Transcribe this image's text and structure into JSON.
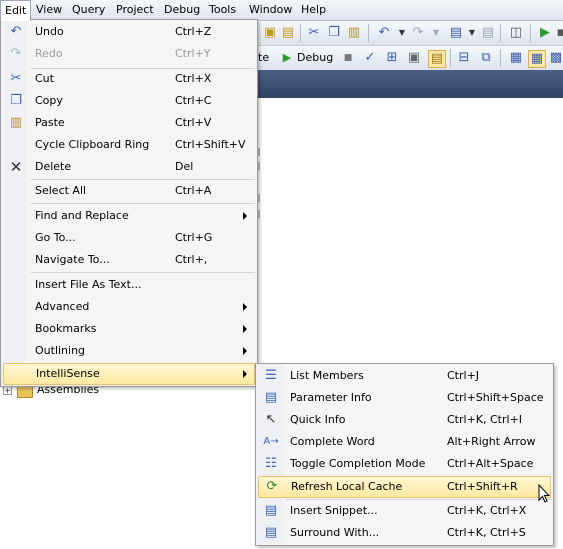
{
  "menubar": {
    "items": [
      "Edit",
      "View",
      "Query",
      "Project",
      "Debug",
      "Tools",
      "Window",
      "Help"
    ]
  },
  "toolbar": {
    "debug_label": "Debug",
    "partial_label": "te"
  },
  "tree": {
    "item_label": "Assemblies"
  },
  "edit_menu": {
    "items": [
      {
        "label": "Undo",
        "shortcut": "Ctrl+Z",
        "icon": "undo-icon"
      },
      {
        "label": "Redo",
        "shortcut": "Ctrl+Y",
        "icon": "redo-icon",
        "disabled": true
      },
      {
        "label": "Cut",
        "shortcut": "Ctrl+X",
        "icon": "cut-icon"
      },
      {
        "label": "Copy",
        "shortcut": "Ctrl+C",
        "icon": "copy-icon"
      },
      {
        "label": "Paste",
        "shortcut": "Ctrl+V",
        "icon": "paste-icon"
      },
      {
        "label": "Cycle Clipboard Ring",
        "shortcut": "Ctrl+Shift+V"
      },
      {
        "label": "Delete",
        "shortcut": "Del",
        "icon": "delete-icon"
      },
      {
        "label": "Select All",
        "shortcut": "Ctrl+A"
      },
      {
        "label": "Find and Replace",
        "shortcut": "",
        "submenu": true
      },
      {
        "label": "Go To...",
        "shortcut": "Ctrl+G"
      },
      {
        "label": "Navigate To...",
        "shortcut": "Ctrl+,"
      },
      {
        "label": "Insert File As Text...",
        "shortcut": ""
      },
      {
        "label": "Advanced",
        "shortcut": "",
        "submenu": true
      },
      {
        "label": "Bookmarks",
        "shortcut": "",
        "submenu": true
      },
      {
        "label": "Outlining",
        "shortcut": "",
        "submenu": true
      },
      {
        "label": "IntelliSense",
        "shortcut": "",
        "submenu": true
      }
    ]
  },
  "intellisense_menu": {
    "items": [
      {
        "label": "List Members",
        "shortcut": "Ctrl+J",
        "icon": "list-members-icon"
      },
      {
        "label": "Parameter Info",
        "shortcut": "Ctrl+Shift+Space",
        "icon": "parameter-info-icon"
      },
      {
        "label": "Quick Info",
        "shortcut": "Ctrl+K, Ctrl+I",
        "icon": "quick-info-icon"
      },
      {
        "label": "Complete Word",
        "shortcut": "Alt+Right Arrow",
        "icon": "complete-word-icon"
      },
      {
        "label": "Toggle Completion Mode",
        "shortcut": "Ctrl+Alt+Space",
        "icon": "toggle-completion-icon"
      },
      {
        "label": "Refresh Local Cache",
        "shortcut": "Ctrl+Shift+R",
        "icon": "refresh-cache-icon"
      },
      {
        "label": "Insert Snippet...",
        "shortcut": "Ctrl+K, Ctrl+X",
        "icon": "insert-snippet-icon"
      },
      {
        "label": "Surround With...",
        "shortcut": "Ctrl+K, Ctrl+S",
        "icon": "surround-with-icon"
      }
    ]
  }
}
